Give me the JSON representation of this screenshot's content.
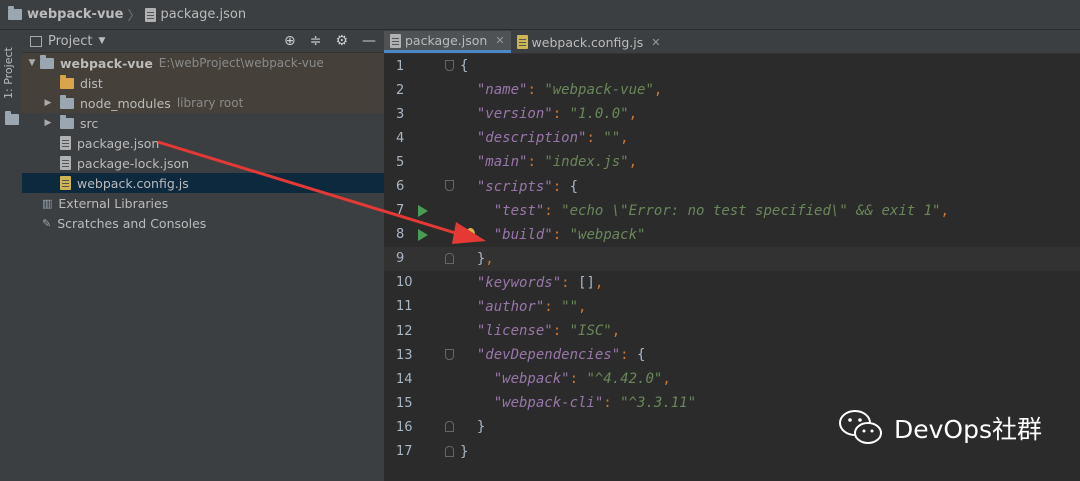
{
  "breadcrumb": {
    "project": "webpack-vue",
    "file": "package.json"
  },
  "sidebar_tab": "1: Project",
  "project_panel": {
    "title": "Project",
    "tree": [
      {
        "label": "webpack-vue",
        "hint": "E:\\webProject\\webpack-vue",
        "type": "root"
      },
      {
        "label": "dist",
        "hint": "",
        "type": "folder-excluded"
      },
      {
        "label": "node_modules",
        "hint": "library root",
        "type": "folder"
      },
      {
        "label": "src",
        "hint": "",
        "type": "folder"
      },
      {
        "label": "package.json",
        "hint": "",
        "type": "json"
      },
      {
        "label": "package-lock.json",
        "hint": "",
        "type": "json"
      },
      {
        "label": "webpack.config.js",
        "hint": "",
        "type": "js"
      },
      {
        "label": "External Libraries",
        "hint": "",
        "type": "libs"
      },
      {
        "label": "Scratches and Consoles",
        "hint": "",
        "type": "scratch"
      }
    ]
  },
  "editor_tabs": [
    {
      "label": "package.json",
      "active": true
    },
    {
      "label": "webpack.config.js",
      "active": false
    }
  ],
  "code_lines": [
    {
      "n": "1",
      "t": "{"
    },
    {
      "n": "2",
      "t": "  \"name\": \"webpack-vue\","
    },
    {
      "n": "3",
      "t": "  \"version\": \"1.0.0\","
    },
    {
      "n": "4",
      "t": "  \"description\": \"\","
    },
    {
      "n": "5",
      "t": "  \"main\": \"index.js\","
    },
    {
      "n": "6",
      "t": "  \"scripts\": {"
    },
    {
      "n": "7",
      "t": "    \"test\": \"echo \\\"Error: no test specified\\\" && exit 1\","
    },
    {
      "n": "8",
      "t": "    \"build\": \"webpack\""
    },
    {
      "n": "9",
      "t": "  },"
    },
    {
      "n": "10",
      "t": "  \"keywords\": [],"
    },
    {
      "n": "11",
      "t": "  \"author\": \"\","
    },
    {
      "n": "12",
      "t": "  \"license\": \"ISC\","
    },
    {
      "n": "13",
      "t": "  \"devDependencies\": {"
    },
    {
      "n": "14",
      "t": "    \"webpack\": \"^4.42.0\","
    },
    {
      "n": "15",
      "t": "    \"webpack-cli\": \"^3.3.11\""
    },
    {
      "n": "16",
      "t": "  }"
    },
    {
      "n": "17",
      "t": "}"
    }
  ],
  "watermark": "DevOps社群",
  "colors": {
    "accent": "#4a88c7",
    "arrow": "#e53935",
    "run": "#499c54"
  }
}
